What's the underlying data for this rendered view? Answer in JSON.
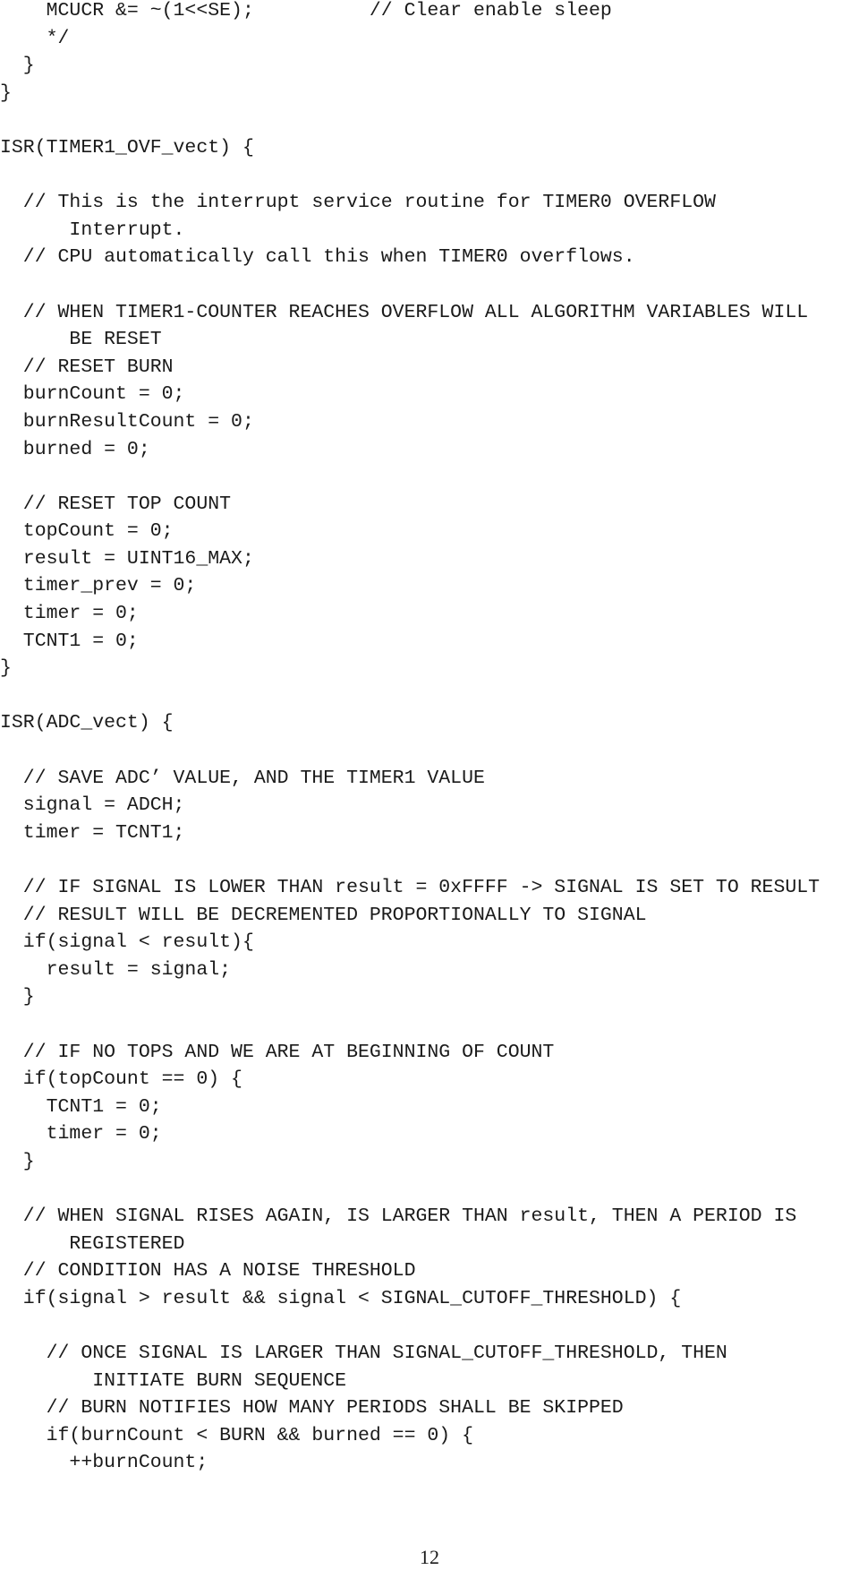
{
  "document": {
    "type": "code-listing",
    "lines": [
      "    MCUCR &= ~(1<<SE);          // Clear enable sleep",
      "    */",
      "  }",
      "}",
      "",
      "ISR(TIMER1_OVF_vect) {",
      "",
      "  // This is the interrupt service routine for TIMER0 OVERFLOW",
      "      Interrupt.",
      "  // CPU automatically call this when TIMER0 overflows.",
      "",
      "  // WHEN TIMER1-COUNTER REACHES OVERFLOW ALL ALGORITHM VARIABLES WILL",
      "      BE RESET",
      "  // RESET BURN",
      "  burnCount = 0;",
      "  burnResultCount = 0;",
      "  burned = 0;",
      "",
      "  // RESET TOP COUNT",
      "  topCount = 0;",
      "  result = UINT16_MAX;",
      "  timer_prev = 0;",
      "  timer = 0;",
      "  TCNT1 = 0;",
      "}",
      "",
      "ISR(ADC_vect) {",
      "",
      "  // SAVE ADC’ VALUE, AND THE TIMER1 VALUE",
      "  signal = ADCH;",
      "  timer = TCNT1;",
      "",
      "  // IF SIGNAL IS LOWER THAN result = 0xFFFF -> SIGNAL IS SET TO RESULT",
      "  // RESULT WILL BE DECREMENTED PROPORTIONALLY TO SIGNAL",
      "  if(signal < result){",
      "    result = signal;",
      "  }",
      "",
      "  // IF NO TOPS AND WE ARE AT BEGINNING OF COUNT",
      "  if(topCount == 0) {",
      "    TCNT1 = 0;",
      "    timer = 0;",
      "  }",
      "",
      "  // WHEN SIGNAL RISES AGAIN, IS LARGER THAN result, THEN A PERIOD IS",
      "      REGISTERED",
      "  // CONDITION HAS A NOISE THRESHOLD",
      "  if(signal > result && signal < SIGNAL_CUTOFF_THRESHOLD) {",
      "",
      "    // ONCE SIGNAL IS LARGER THAN SIGNAL_CUTOFF_THRESHOLD, THEN",
      "        INITIATE BURN SEQUENCE",
      "    // BURN NOTIFIES HOW MANY PERIODS SHALL BE SKIPPED",
      "    if(burnCount < BURN && burned == 0) {",
      "      ++burnCount;"
    ],
    "page_number": "12"
  }
}
